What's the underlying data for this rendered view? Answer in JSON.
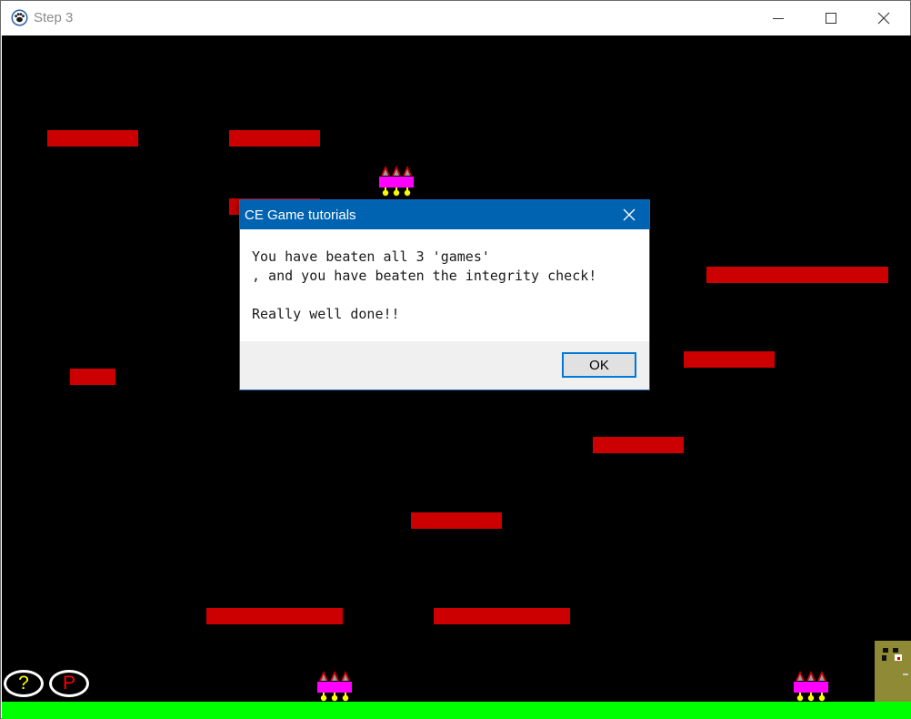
{
  "window": {
    "title": "Step 3",
    "app_icon": "paw-icon",
    "controls": [
      "minimize-icon",
      "maximize-icon",
      "close-icon"
    ]
  },
  "game": {
    "background": "#000000",
    "platform_color": "#cc0000",
    "ground_color": "#00ff00",
    "platform_count": 12,
    "enemies": 3,
    "buttons": {
      "help_label": "?",
      "pause_label": "P"
    }
  },
  "dialog": {
    "title": "CE Game tutorials",
    "message": "You have beaten all 3 'games'\n, and you have beaten the integrity check!\n\nReally well done!!",
    "ok_label": "OK",
    "title_color": "#0063b1"
  }
}
